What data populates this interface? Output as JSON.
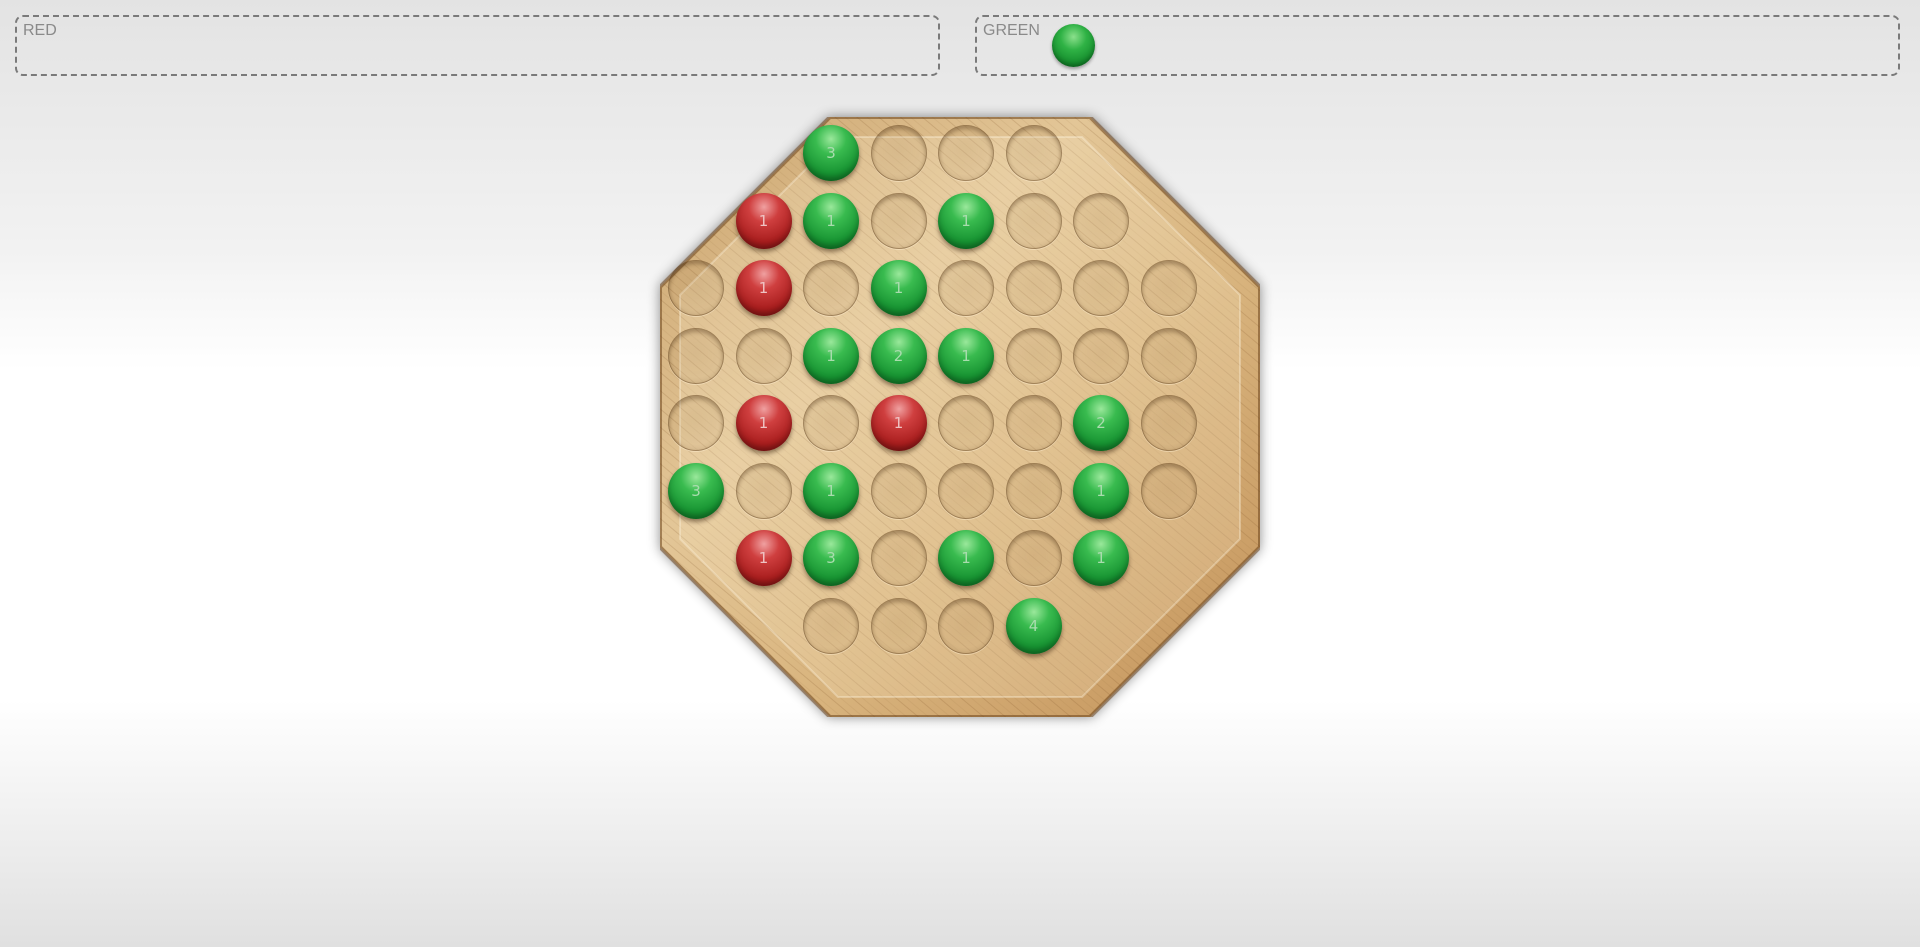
{
  "players": {
    "red": {
      "label": "RED",
      "color": "#c0392b",
      "active": false
    },
    "green": {
      "label": "GREEN",
      "color": "#1e9e3a",
      "active": true,
      "turn_icon": "green-marble-icon"
    }
  },
  "board": {
    "shape": "octagon",
    "material": "wood",
    "rows": 8,
    "cols": 8,
    "colors": {
      "green": "#1e9e3a",
      "red": "#b22222",
      "wood": "#c9a06a"
    },
    "grid": [
      [
        null,
        null,
        "G3",
        "E",
        "E",
        "E",
        null,
        null
      ],
      [
        null,
        "R1",
        "G1",
        "E",
        "G1",
        "E",
        "E",
        null
      ],
      [
        "E",
        "R1",
        "E",
        "G1",
        "E",
        "E",
        "E",
        "E"
      ],
      [
        "E",
        "E",
        "G1",
        "G2",
        "G1",
        "E",
        "E",
        "E"
      ],
      [
        "E",
        "R1",
        "E",
        "R1",
        "E",
        "E",
        "G2",
        "E"
      ],
      [
        "G3",
        "E",
        "G1",
        "E",
        "E",
        "E",
        "G1",
        "E"
      ],
      [
        null,
        "R1",
        "G3",
        "E",
        "G1",
        "E",
        "G1",
        null
      ],
      [
        null,
        null,
        "E",
        "E",
        "E",
        "G4",
        null,
        null
      ]
    ]
  }
}
